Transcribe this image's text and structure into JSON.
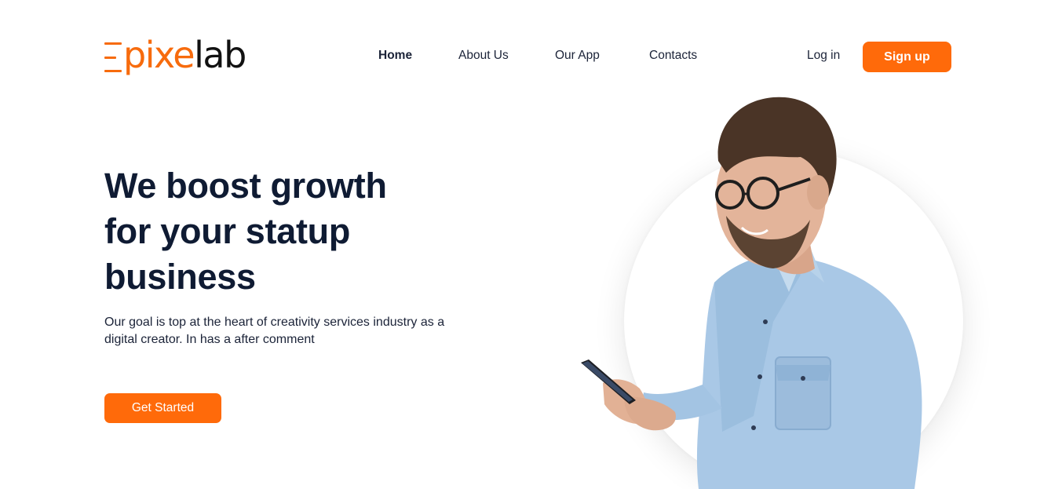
{
  "brand": {
    "logo_text_accent": "pixe",
    "logo_text_dark": "lab",
    "accent_color": "#ff6a0a"
  },
  "nav": {
    "items": [
      {
        "label": "Home",
        "active": true
      },
      {
        "label": "About Us",
        "active": false
      },
      {
        "label": "Our App",
        "active": false
      },
      {
        "label": "Contacts",
        "active": false
      }
    ],
    "login_label": "Log in",
    "signup_label": "Sign up"
  },
  "hero": {
    "title_lines": [
      "We boost growth",
      "for your statup",
      "business"
    ],
    "description": "Our goal is top at the heart of creativity services industry as a digital creator. In has a after comment",
    "cta_label": "Get Started"
  }
}
